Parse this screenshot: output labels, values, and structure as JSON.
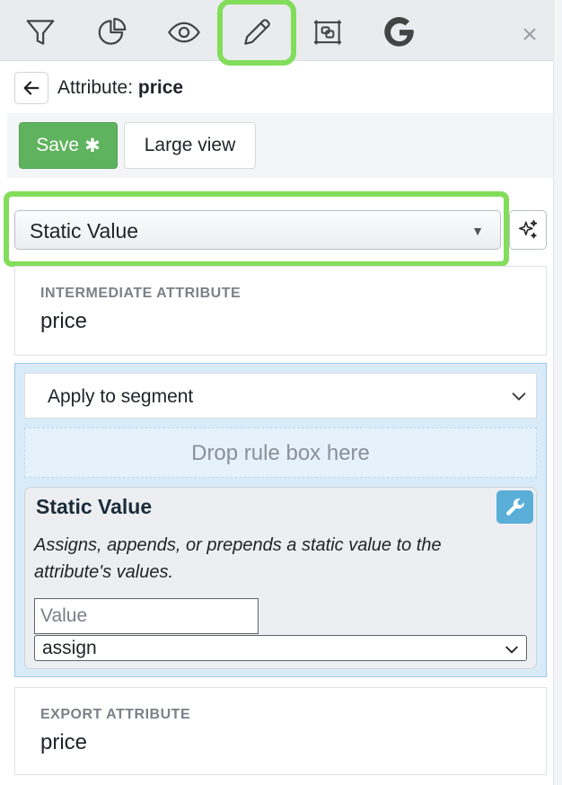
{
  "toolbar": {
    "tools": [
      {
        "icon": "filter-icon",
        "active": false
      },
      {
        "icon": "pie-chart-icon",
        "active": false
      },
      {
        "icon": "eye-icon",
        "active": false
      },
      {
        "icon": "pencil-icon",
        "active": true
      },
      {
        "icon": "layout-frame-icon",
        "active": false
      },
      {
        "icon": "google-icon",
        "active": false
      }
    ],
    "close_label": "×",
    "highlight_color": "#82dd5a"
  },
  "header": {
    "prefix": "Attribute:",
    "attribute_name": "price"
  },
  "actions": {
    "save_label": "Save",
    "save_marker": "✱",
    "large_view_label": "Large view",
    "save_color": "#5fb35e"
  },
  "rule_type": {
    "selected": "Static Value",
    "arrow": "▼"
  },
  "intermediate": {
    "label": "INTERMEDIATE ATTRIBUTE",
    "value": "price"
  },
  "segment": {
    "selected": "Apply to segment",
    "drop_zone_text": "Drop rule box here"
  },
  "rule_card": {
    "title": "Static Value",
    "description": "Assigns, appends, or prepends a static value to the attribute's values.",
    "value_placeholder": "Value",
    "value": "",
    "mode_selected": "assign",
    "wrench_color": "#5aafd9"
  },
  "export": {
    "label": "EXPORT ATTRIBUTE",
    "value": "price"
  }
}
